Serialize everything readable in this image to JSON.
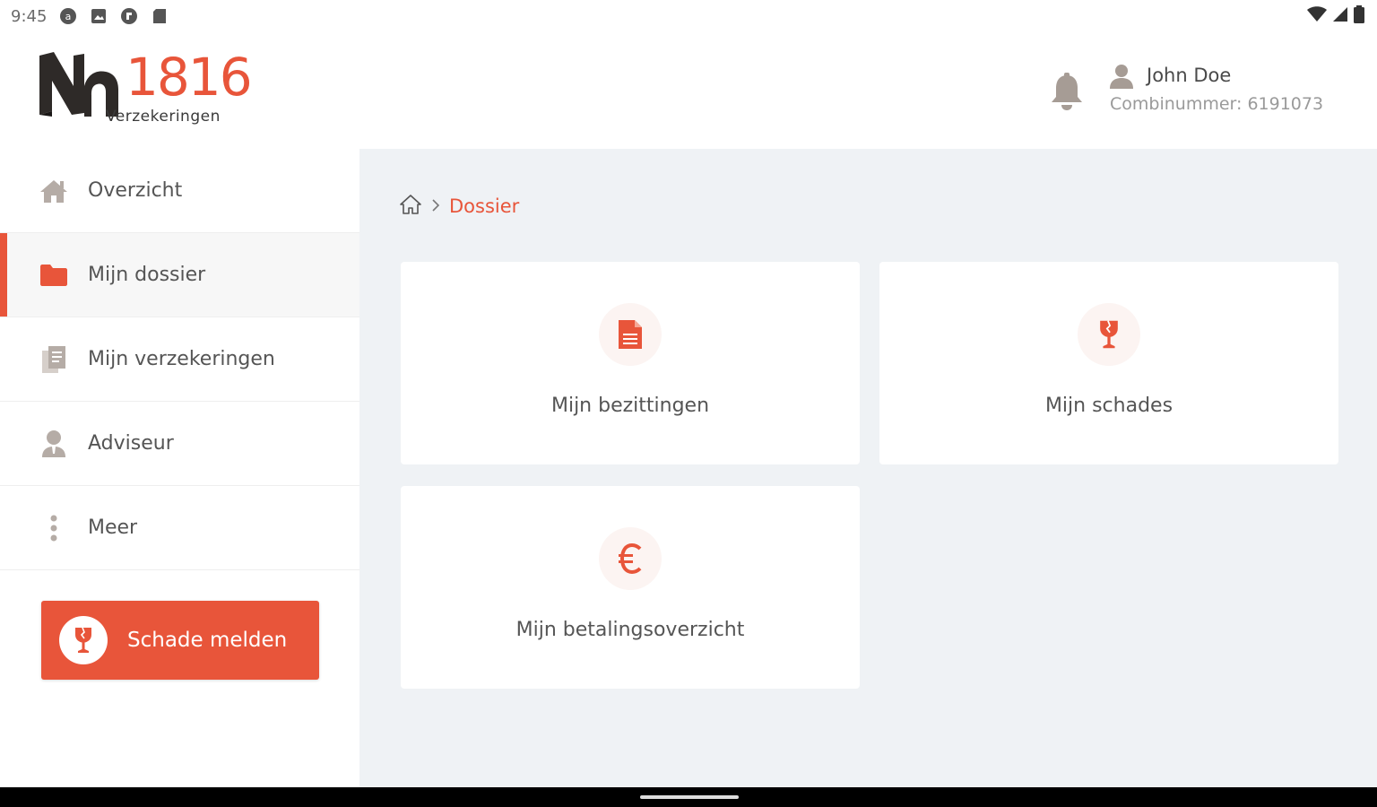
{
  "status_bar": {
    "time": "9:45",
    "icons": [
      "app-notification-icon",
      "image-notification-icon",
      "app-notification-icon",
      "sd-card-icon"
    ],
    "right_icons": [
      "wifi-icon",
      "signal-icon",
      "battery-icon"
    ]
  },
  "header": {
    "logo": {
      "mark": "Nh",
      "number": "1816",
      "subtitle": "Verzekeringen"
    },
    "user": {
      "name": "John Doe",
      "number_text": "Combinummer: 6191073"
    },
    "icons": {
      "notifications": "bell-icon",
      "user": "user-icon"
    }
  },
  "sidebar": {
    "items": [
      {
        "label": "Overzicht",
        "icon": "home-icon",
        "active": false
      },
      {
        "label": "Mijn dossier",
        "icon": "folder-icon",
        "active": true
      },
      {
        "label": "Mijn verzekeringen",
        "icon": "documents-icon",
        "active": false
      },
      {
        "label": "Adviseur",
        "icon": "advisor-icon",
        "active": false
      },
      {
        "label": "Meer",
        "icon": "more-vertical-icon",
        "active": false
      }
    ],
    "report_button": {
      "label": "Schade melden",
      "icon": "broken-glass-icon"
    }
  },
  "breadcrumb": {
    "home_icon": "home-outline-icon",
    "separator_icon": "chevron-right-icon",
    "current": "Dossier"
  },
  "cards": [
    {
      "label": "Mijn bezittingen",
      "icon": "document-icon"
    },
    {
      "label": "Mijn schades",
      "icon": "broken-glass-icon"
    },
    {
      "label": "Mijn betalingsoverzicht",
      "icon": "euro-icon"
    }
  ],
  "colors": {
    "accent": "#e8553a",
    "background": "#eff2f5",
    "text": "#555555",
    "muted": "#9a9a9a",
    "icon_gray": "#b5aca6"
  }
}
